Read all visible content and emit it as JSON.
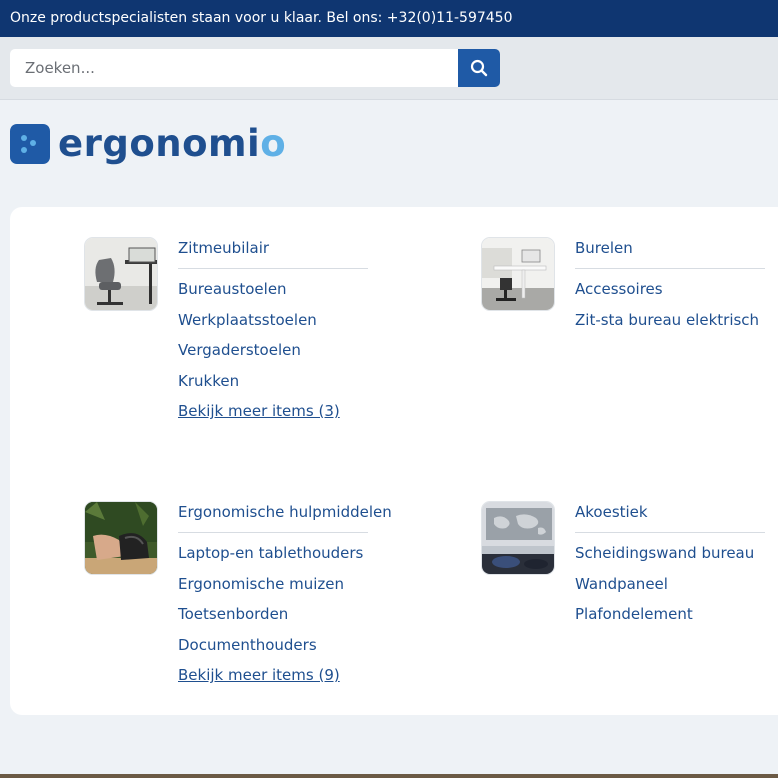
{
  "topbar": {
    "text": "Onze productspecialisten staan voor u klaar. Bel ons: +32(0)11-597450"
  },
  "search": {
    "placeholder": "Zoeken..."
  },
  "logo": {
    "text_main": "ergonomi",
    "text_accent": "o"
  },
  "colors": {
    "topbar_bg": "#0f3671",
    "brand_blue": "#1f5aa6",
    "link_blue": "#1f4f8f",
    "accent_light_blue": "#5fb0e6",
    "page_bg": "#eef2f6"
  },
  "categories": [
    {
      "title": "Zitmeubilair",
      "links": [
        "Bureaustoelen",
        "Werkplaatsstoelen",
        "Vergaderstoelen",
        "Krukken"
      ],
      "more": "Bekijk meer items (3)"
    },
    {
      "title": "Burelen",
      "links": [
        "Accessoires",
        "Zit-sta bureau elektrisch"
      ],
      "more": ""
    },
    {
      "title": "Ergonomische hulpmiddelen",
      "links": [
        "Laptop-en tablethouders",
        "Ergonomische muizen",
        "Toetsenborden",
        "Documenthouders"
      ],
      "more": "Bekijk meer items (9)"
    },
    {
      "title": "Akoestiek",
      "links": [
        "Scheidingswand bureau",
        "Wandpaneel",
        "Plafondelement"
      ],
      "more": ""
    }
  ]
}
